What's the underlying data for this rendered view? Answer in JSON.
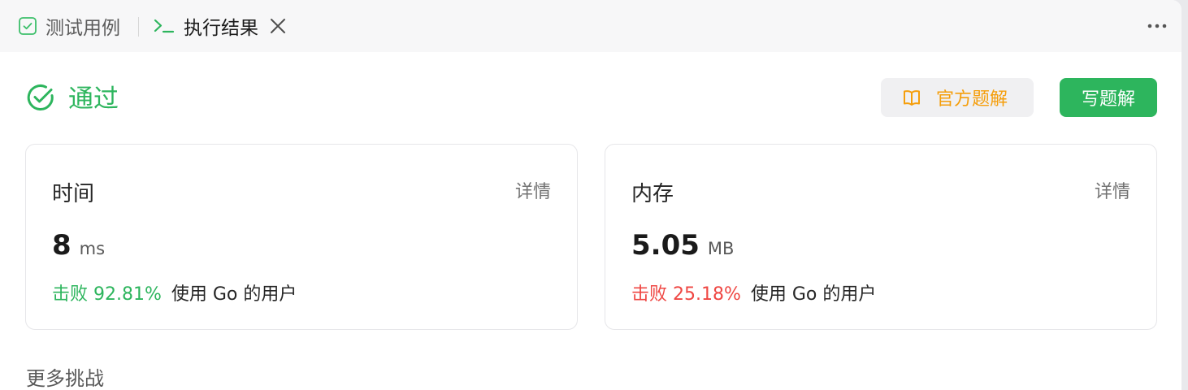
{
  "tabs": [
    {
      "label": "测试用例",
      "icon": "checkbox-icon"
    },
    {
      "label": "执行结果",
      "icon": "terminal-icon"
    }
  ],
  "status": {
    "text": "通过",
    "icon": "check-circle-icon"
  },
  "buttons": {
    "official_solution": "官方题解",
    "write_solution": "写题解"
  },
  "time_card": {
    "title": "时间",
    "detail": "详情",
    "value": "8",
    "unit": "ms",
    "beat_label": "击败 92.81%",
    "beat_suffix": "使用 Go 的用户"
  },
  "memory_card": {
    "title": "内存",
    "detail": "详情",
    "value": "5.05",
    "unit": "MB",
    "beat_label": "击败 25.18%",
    "beat_suffix": "使用 Go 的用户"
  },
  "more_challenges": "更多挑战",
  "colors": {
    "accent_green": "#2db55d",
    "orange": "#f59e0b",
    "red": "#ef4743"
  }
}
